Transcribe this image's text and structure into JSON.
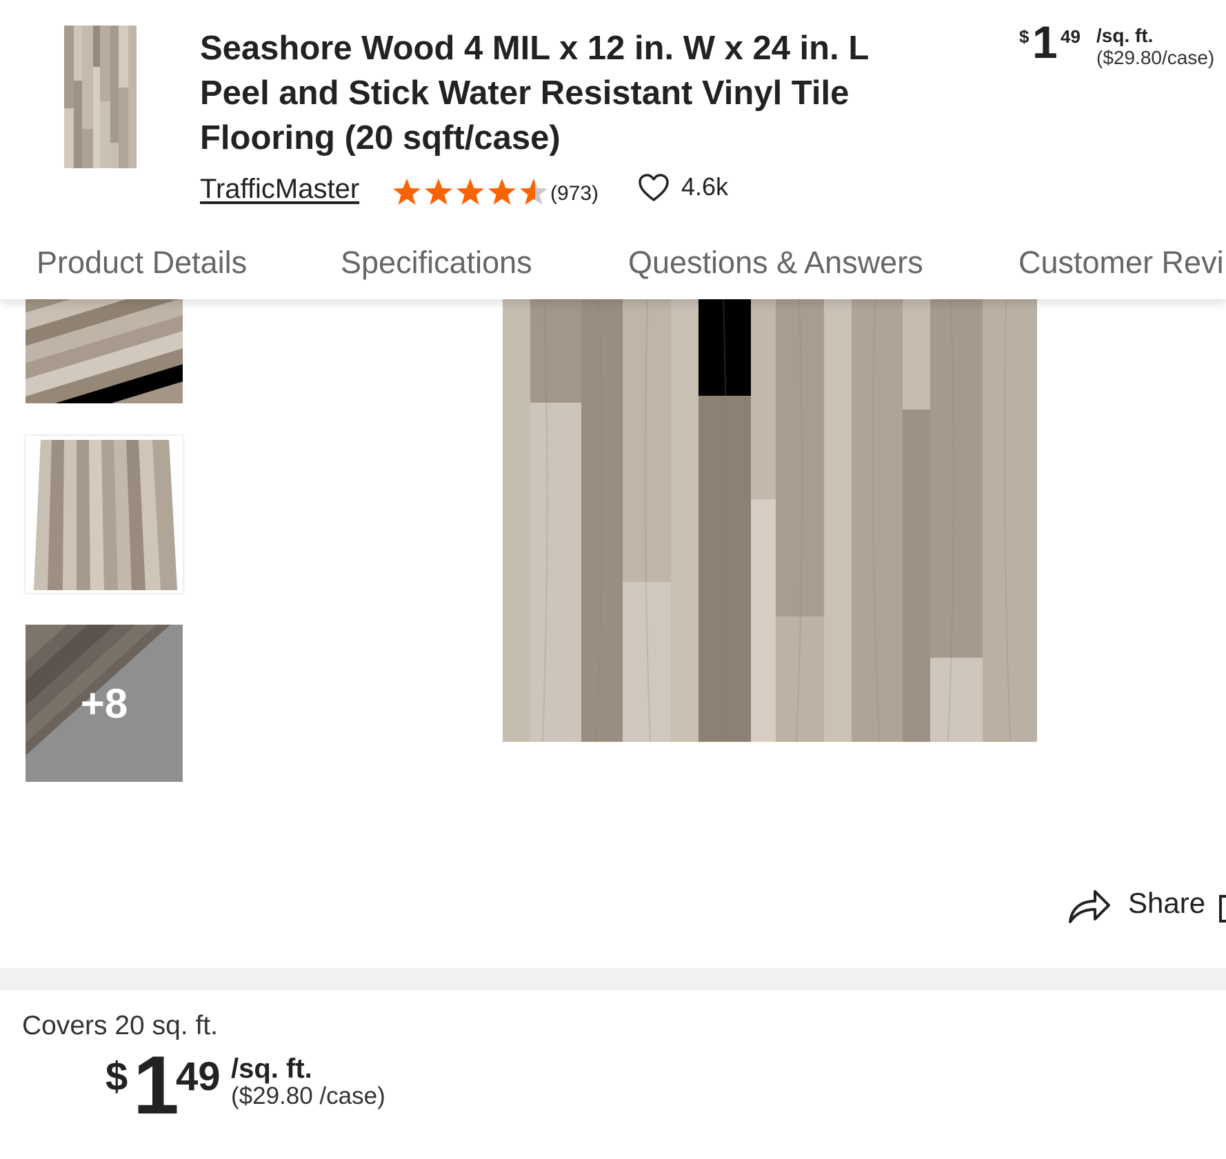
{
  "product": {
    "title": "Seashore Wood 4 MIL x 12 in. W x 24 in. L Peel and Stick Water Resistant Vinyl Tile Flooring (20 sqft/case)",
    "brand": "TrafficMaster",
    "rating": 4.5,
    "rating_max": 5,
    "review_count": "(973)",
    "favorites": "4.6k"
  },
  "price_header": {
    "dollar_sign": "$",
    "whole": "1",
    "cents": "49",
    "unit": "/sq. ft.",
    "per_case": "($29.80/case)"
  },
  "tabs": [
    "Product Details",
    "Specifications",
    "Questions & Answers",
    "Customer Revi"
  ],
  "gallery": {
    "more_count": "+8"
  },
  "actions": {
    "share_label": "Share"
  },
  "coverage": "Covers 20 sq. ft.",
  "price_main": {
    "dollar_sign": "$",
    "whole": "1",
    "cents": "49",
    "unit": "/sq. ft.",
    "per_case": "($29.80 /case)"
  },
  "colors": {
    "star": "#f96302",
    "star_empty": "#c8c8c8",
    "tab_text": "#666666",
    "wood_base": "#b4aa9e"
  },
  "icons": [
    "heart-icon",
    "star-icon",
    "share-icon"
  ]
}
